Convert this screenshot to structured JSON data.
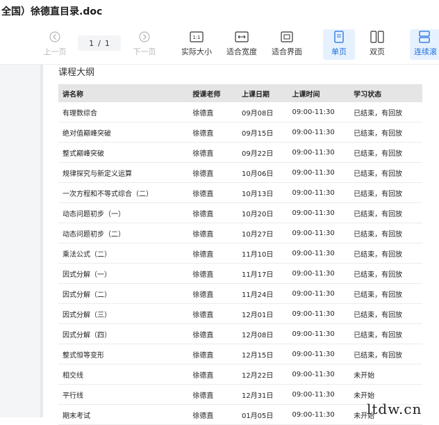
{
  "window": {
    "title": "全国）徐德直目录.doc"
  },
  "toolbar": {
    "prev_label": "上一页",
    "page_current": "1",
    "page_sep": "/",
    "page_total": "1",
    "next_label": "下一页",
    "actual_size_label": "实际大小",
    "fit_width_label": "适合宽度",
    "fit_page_label": "适合界面",
    "single_page_label": "单页",
    "double_page_label": "双页",
    "continuous_label": "连续滚"
  },
  "content": {
    "section_title": "课程大纲",
    "columns": [
      "讲名称",
      "授课老师",
      "上课日期",
      "上课时间",
      "学习状态"
    ],
    "rows": [
      [
        "有理数综合",
        "徐德直",
        "09月08日",
        "09:00-11:30",
        "已结束，有回放"
      ],
      [
        "绝对值巅峰突破",
        "徐德直",
        "09月15日",
        "09:00-11:30",
        "已结束，有回放"
      ],
      [
        "整式巅峰突破",
        "徐德直",
        "09月22日",
        "09:00-11:30",
        "已结束，有回放"
      ],
      [
        "规律探究与新定义运算",
        "徐德直",
        "10月06日",
        "09:00-11:30",
        "已结束，有回放"
      ],
      [
        "一次方程和不等式综合（二）",
        "徐德直",
        "10月13日",
        "09:00-11:30",
        "已结束，有回放"
      ],
      [
        "动态问题初步（一）",
        "徐德直",
        "10月20日",
        "09:00-11:30",
        "已结束，有回放"
      ],
      [
        "动态问题初步（二）",
        "徐德直",
        "10月27日",
        "09:00-11:30",
        "已结束，有回放"
      ],
      [
        "乘法公式（二）",
        "徐德直",
        "11月10日",
        "09:00-11:30",
        "已结束，有回放"
      ],
      [
        "因式分解（一）",
        "徐德直",
        "11月17日",
        "09:00-11:30",
        "已结束，有回放"
      ],
      [
        "因式分解（二）",
        "徐德直",
        "11月24日",
        "09:00-11:30",
        "已结束，有回放"
      ],
      [
        "因式分解（三）",
        "徐德直",
        "12月01日",
        "09:00-11:30",
        "已结束，有回放"
      ],
      [
        "因式分解（四）",
        "徐德直",
        "12月08日",
        "09:00-11:30",
        "已结束，有回放"
      ],
      [
        "整式恒等变形",
        "徐德直",
        "12月15日",
        "09:00-11:30",
        "已结束，有回放"
      ],
      [
        "相交线",
        "徐德直",
        "12月22日",
        "09:00-11:30",
        "未开始"
      ],
      [
        "平行线",
        "徐德直",
        "12月31日",
        "09:00-11:30",
        "未开始"
      ],
      [
        "期末考试",
        "徐德直",
        "01月05日",
        "09:00-11:30",
        "未开始"
      ]
    ]
  },
  "watermark": "ltdw.cn",
  "colors": {
    "accent": "#1e6fd9",
    "active_bg": "#e6f1ff",
    "header_bg": "#e5e5e5"
  }
}
